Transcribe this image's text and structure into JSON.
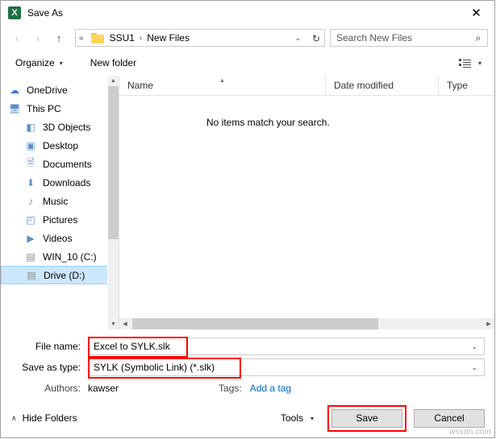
{
  "window": {
    "title": "Save As",
    "app_icon_letter": "X",
    "close_label": "✕"
  },
  "nav": {
    "back": "‹",
    "forward": "›",
    "up": "↑",
    "breadcrumb_prefix": "«",
    "breadcrumb": [
      "SSU1",
      "New Files"
    ],
    "breadcrumb_sep": "›",
    "dropdown_caret": "⌄",
    "refresh": "↻",
    "search_placeholder": "Search New Files",
    "search_icon": "⌕"
  },
  "toolbar": {
    "organize": "Organize",
    "organize_caret": "▾",
    "new_folder": "New folder",
    "view_caret": "▾"
  },
  "sidebar": {
    "items": [
      {
        "label": "OneDrive",
        "icon": "☁",
        "icon_color": "#3a7fd5",
        "indent": false,
        "selected": false
      },
      {
        "label": "This PC",
        "icon": "🖥",
        "icon_color": "#5b8fc9",
        "indent": false,
        "selected": false
      },
      {
        "label": "3D Objects",
        "icon": "◧",
        "icon_color": "#5b8fc9",
        "indent": true,
        "selected": false
      },
      {
        "label": "Desktop",
        "icon": "▣",
        "icon_color": "#5b8fc9",
        "indent": true,
        "selected": false
      },
      {
        "label": "Documents",
        "icon": "🗎",
        "icon_color": "#5b8fc9",
        "indent": true,
        "selected": false
      },
      {
        "label": "Downloads",
        "icon": "⬇",
        "icon_color": "#5b8fc9",
        "indent": true,
        "selected": false
      },
      {
        "label": "Music",
        "icon": "♪",
        "icon_color": "#5b8fc9",
        "indent": true,
        "selected": false
      },
      {
        "label": "Pictures",
        "icon": "◰",
        "icon_color": "#5b8fc9",
        "indent": true,
        "selected": false
      },
      {
        "label": "Videos",
        "icon": "▶",
        "icon_color": "#5b8fc9",
        "indent": true,
        "selected": false
      },
      {
        "label": "WIN_10 (C:)",
        "icon": "▤",
        "icon_color": "#8a8a8a",
        "indent": true,
        "selected": false
      },
      {
        "label": "Drive (D:)",
        "icon": "▤",
        "icon_color": "#8a8a8a",
        "indent": true,
        "selected": true
      }
    ],
    "scroll_up": "▲",
    "scroll_down": "▼"
  },
  "filelist": {
    "columns": [
      {
        "label": "Name",
        "sorted": true
      },
      {
        "label": "Date modified",
        "sorted": false
      },
      {
        "label": "Type",
        "sorted": false
      }
    ],
    "sort_caret": "▴",
    "empty_message": "No items match your search.",
    "hscroll_left": "◀",
    "hscroll_right": "▶"
  },
  "form": {
    "file_name_label": "File name:",
    "file_name_value": "Excel to SYLK.slk",
    "save_as_type_label": "Save as type:",
    "save_as_type_value": "SYLK (Symbolic Link) (*.slk)",
    "combo_caret": "⌄",
    "authors_label": "Authors:",
    "authors_value": "kawser",
    "tags_label": "Tags:",
    "tags_value": "Add a tag"
  },
  "footer": {
    "hide_folders": "Hide Folders",
    "hide_folders_caret": "∧",
    "tools_label": "Tools",
    "tools_caret": "▾",
    "save_label": "Save",
    "cancel_label": "Cancel"
  },
  "watermark": "wsxdn.com",
  "colors": {
    "highlight": "#ff0000",
    "selection": "#cce8ff",
    "link": "#0066cc",
    "excel_green": "#1e7145"
  }
}
